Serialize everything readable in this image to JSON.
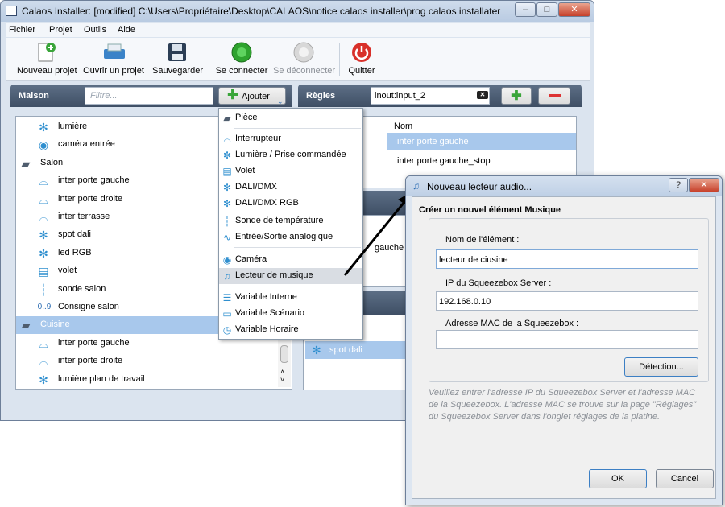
{
  "window": {
    "title": "Calaos Installer: [modified] C:\\Users\\Propriétaire\\Desktop\\CALAOS\\notice calaos installer\\prog calaos installater"
  },
  "menu": [
    "Fichier",
    "Projet",
    "Outils",
    "Aide"
  ],
  "toolbar": {
    "new": "Nouveau projet",
    "open": "Ouvrir un projet",
    "save": "Sauvegarder",
    "connect": "Se connecter",
    "disconnect": "Se déconnecter",
    "quit": "Quitter"
  },
  "maison": {
    "header": "Maison",
    "filter_placeholder": "Filtre...",
    "add_label": "Ajouter",
    "items": [
      {
        "label": "lumière",
        "icon": "light-icon"
      },
      {
        "label": "caméra entrée",
        "icon": "camera-icon"
      },
      {
        "label": "Salon",
        "icon": "room-icon"
      },
      {
        "label": "inter porte gauche",
        "icon": "switch-icon"
      },
      {
        "label": "inter porte droite",
        "icon": "switch-icon"
      },
      {
        "label": "inter terrasse",
        "icon": "switch-icon"
      },
      {
        "label": "spot dali",
        "icon": "light-icon"
      },
      {
        "label": "led RGB",
        "icon": "light-icon"
      },
      {
        "label": "volet",
        "icon": "shutter-icon"
      },
      {
        "label": "sonde salon",
        "icon": "temp-icon"
      },
      {
        "label": "Consigne salon",
        "icon": "var-icon",
        "prefix": "0..9"
      },
      {
        "label": "Cuisine",
        "icon": "room-icon"
      },
      {
        "label": "inter porte gauche",
        "icon": "switch-icon"
      },
      {
        "label": "inter porte droite",
        "icon": "switch-icon"
      },
      {
        "label": "lumière plan de travail",
        "icon": "light-icon"
      }
    ]
  },
  "regles": {
    "header": "Règles",
    "search_value": "inout:input_2",
    "column": "Nom",
    "rows": [
      "inter porte gauche",
      "inter porte gauche_stop"
    ],
    "partial_label": "gauche",
    "spot_label": "spot dali"
  },
  "dropdown": [
    {
      "label": "Pièce",
      "icon": "room-icon"
    },
    {
      "label": "Interrupteur",
      "icon": "switch-icon"
    },
    {
      "label": "Lumière / Prise commandée",
      "icon": "light-icon"
    },
    {
      "label": "Volet",
      "icon": "shutter-icon"
    },
    {
      "label": "DALI/DMX",
      "icon": "light-icon"
    },
    {
      "label": "DALI/DMX RGB",
      "icon": "light-icon"
    },
    {
      "label": "Sonde de température",
      "icon": "temp-icon"
    },
    {
      "label": "Entrée/Sortie analogique",
      "icon": "analog-icon"
    },
    {
      "label": "Caméra",
      "icon": "camera-icon"
    },
    {
      "label": "Lecteur de musique",
      "icon": "music-icon"
    },
    {
      "label": "Variable Interne",
      "icon": "var-icon"
    },
    {
      "label": "Variable Scénario",
      "icon": "scenario-icon"
    },
    {
      "label": "Variable Horaire",
      "icon": "clock-icon"
    }
  ],
  "dialog": {
    "title": "Nouveau lecteur audio...",
    "group_title": "Créer un nouvel élément Musique",
    "name_label": "Nom de l'élément :",
    "name_value": "lecteur de ciusine",
    "ip_label": "IP du Squeezebox Server :",
    "ip_value": "192.168.0.10",
    "mac_label": "Adresse MAC de la Squeezebox :",
    "mac_value": "",
    "detect_label": "Détection...",
    "help": "Veuillez entrer l'adresse IP du Squeezebox Server et l'adresse MAC de la Squeezebox. L'adresse MAC se trouve sur la page \"Réglages\" du Squeezebox Server dans l'onglet réglages de la platine.",
    "ok_label": "OK",
    "cancel_label": "Cancel"
  },
  "colors": {
    "accent": "#2f8fcf",
    "panel_header": "#4a5a70",
    "selection": "#a8c8ec"
  }
}
